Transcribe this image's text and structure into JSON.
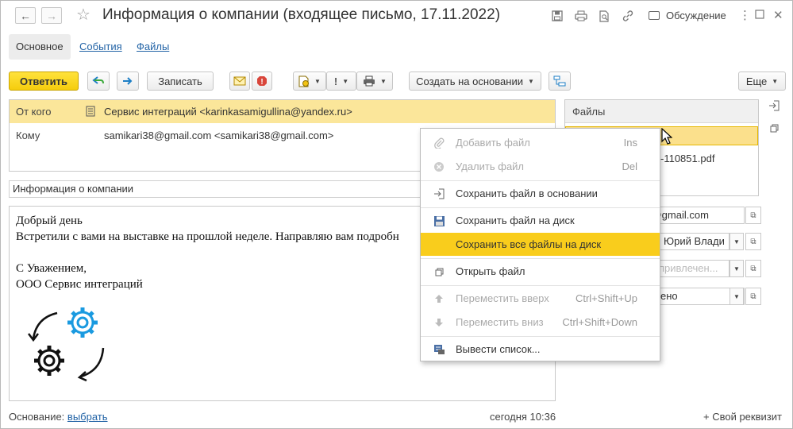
{
  "window": {
    "title": "Информация о компании (входящее письмо, 17.11.2022)",
    "discussion_label": "Обсуждение"
  },
  "tabs": [
    {
      "label": "Основное"
    },
    {
      "label": "События"
    },
    {
      "label": "Файлы"
    }
  ],
  "toolbar": {
    "reply_label": "Ответить",
    "save_label": "Записать",
    "create_based_label": "Создать на основании",
    "more_label": "Еще"
  },
  "header": {
    "from_label": "От кого",
    "from_value": "Сервис интеграций <karinkasamigullina@yandex.ru>",
    "to_label": "Кому",
    "to_value": "samikari38@gmail.com <samikari38@gmail.com>"
  },
  "subject": "Информация о компании",
  "body": {
    "lines": [
      "Добрый день",
      "Встретили с вами на выставке на прошлой неделе. Направляю вам подробн",
      "",
      "С Уважением,",
      "ООО Сервис интеграций"
    ]
  },
  "files": {
    "header": "Файлы",
    "row2": "-110851.pdf"
  },
  "right_fields": {
    "email": "38@gmail.com",
    "person": "Юрий Влади",
    "attract_placeholder": "привлечен...",
    "status": "ено"
  },
  "footer": {
    "basis_label": "Основание:",
    "basis_link": "выбрать",
    "time": "сегодня 10:36",
    "own_attr": "+ Свой реквизит"
  },
  "context_menu": {
    "items": [
      {
        "label": "Добавить файл",
        "shortcut": "Ins",
        "disabled": true,
        "icon": "paperclip-icon"
      },
      {
        "label": "Удалить файл",
        "shortcut": "Del",
        "disabled": true,
        "icon": "delete-icon"
      },
      {
        "label": "Сохранить файл в основании",
        "shortcut": "",
        "disabled": false,
        "icon": "save-to-basis-icon"
      },
      {
        "label": "Сохранить файл на диск",
        "shortcut": "",
        "disabled": false,
        "icon": "save-disk-icon"
      },
      {
        "label": "Сохранить все файлы на диск",
        "shortcut": "",
        "disabled": false,
        "highlighted": true,
        "icon": "none"
      },
      {
        "label": "Открыть файл",
        "shortcut": "",
        "disabled": false,
        "icon": "open-icon"
      },
      {
        "label": "Переместить вверх",
        "shortcut": "Ctrl+Shift+Up",
        "disabled": true,
        "icon": "arrow-up-icon"
      },
      {
        "label": "Переместить вниз",
        "shortcut": "Ctrl+Shift+Down",
        "disabled": true,
        "icon": "arrow-down-icon"
      },
      {
        "label": "Вывести список...",
        "shortcut": "",
        "disabled": false,
        "icon": "list-output-icon"
      }
    ]
  },
  "colors": {
    "accent_yellow": "#f9cd1c",
    "highlight_row": "#fbe69a",
    "link": "#2263a6",
    "gear_blue": "#1a9ae0"
  }
}
